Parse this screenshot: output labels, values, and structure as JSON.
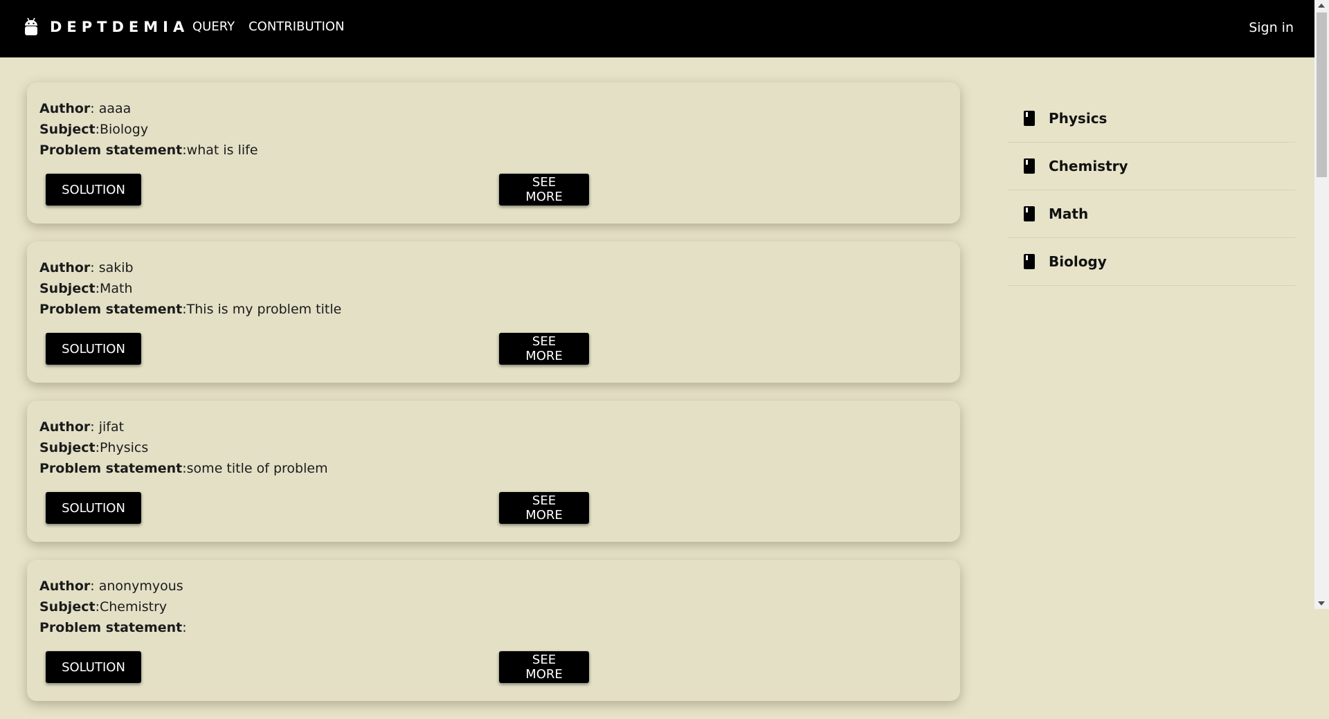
{
  "brand": {
    "name": "DEPTDEMIA",
    "icon": "android-icon"
  },
  "nav": {
    "links": [
      "QUERY",
      "CONTRIBUTION"
    ],
    "signin": "Sign in"
  },
  "posts": [
    {
      "author_label": "Author",
      "author": "aaaa",
      "subject_label": "Subject",
      "subject": "Biology",
      "problem_label": "Problem statement",
      "problem": "what is life",
      "solution_button": "SOLUTION",
      "see_more_button": "SEE MORE"
    },
    {
      "author_label": "Author",
      "author": "sakib",
      "subject_label": "Subject",
      "subject": "Math",
      "problem_label": "Problem statement",
      "problem": "This is my problem title",
      "solution_button": "SOLUTION",
      "see_more_button": "SEE MORE"
    },
    {
      "author_label": "Author",
      "author": "jifat",
      "subject_label": "Subject",
      "subject": "Physics",
      "problem_label": "Problem statement",
      "problem": "some title of problem",
      "solution_button": "SOLUTION",
      "see_more_button": "SEE MORE"
    },
    {
      "author_label": "Author",
      "author": "anonymyous",
      "subject_label": "Subject",
      "subject": "Chemistry",
      "problem_label": "Problem statement",
      "problem": "",
      "solution_button": "SOLUTION",
      "see_more_button": "SEE MORE"
    }
  ],
  "sidebar": {
    "subjects": [
      {
        "label": "Physics",
        "icon": "book-icon"
      },
      {
        "label": "Chemistry",
        "icon": "book-icon"
      },
      {
        "label": "Math",
        "icon": "book-icon"
      },
      {
        "label": "Biology",
        "icon": "book-icon"
      }
    ]
  }
}
